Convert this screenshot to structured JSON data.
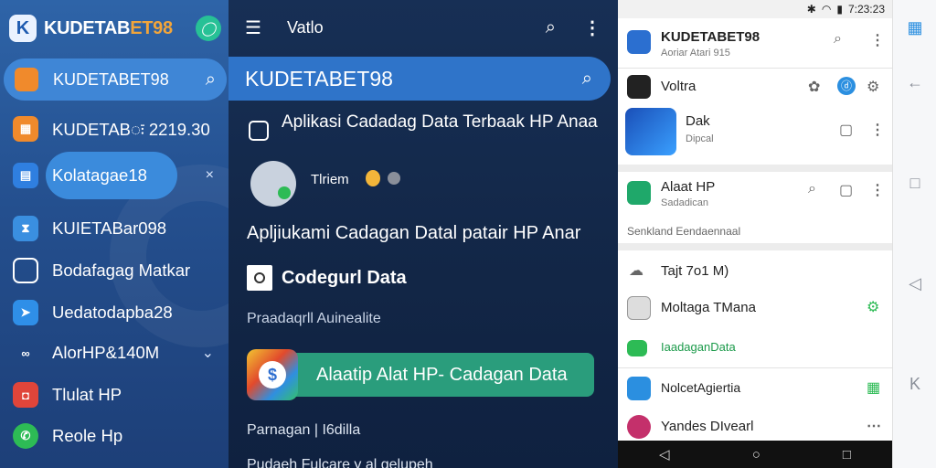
{
  "sidebar": {
    "title_main": "KUDETAB",
    "title_accent": "ET98",
    "search_label": "KUDETABET98",
    "items": [
      {
        "label": "KUDETABः 2219.30",
        "trail": ""
      },
      {
        "label": "Kolatagae18",
        "trail": "×"
      },
      {
        "label": "KUIETABar098",
        "trail": ""
      },
      {
        "label": "Bodafagag Matkar",
        "trail": ""
      },
      {
        "label": "Uedatodapba28",
        "trail": ""
      },
      {
        "label": "AlorHP&140M",
        "trail": "⌄"
      },
      {
        "label": "Tlulat HP",
        "trail": ""
      },
      {
        "label": "Reole Hp",
        "trail": ""
      }
    ]
  },
  "main": {
    "top_title": "Vatlo",
    "bar_title": "KUDETABET98",
    "card_title": "Aplikasi Cadadag Data Terbaak HP Anaa",
    "row_label": "Tlriem",
    "line1": "Apljiukami Cadagan Datal patair HP Anar",
    "section_title": "Codegurl Data",
    "section_sub": "Praadaqrll Auinealite",
    "cta_label": "Alaatip Alat HP- Cadagan Data",
    "footer": "Parnagan | I6dilla",
    "footer2": "Pudaeh Fulcare y al gelupeh"
  },
  "phone": {
    "status_time": "7:23:23",
    "header_title": "KUDETABET98",
    "header_sub": "Aoriar Atari 915",
    "row_volta": "Voltra",
    "row_dak_title": "Dak",
    "row_dak_sub": "Dipcal",
    "row_alat_title": "Alaat HP",
    "row_alat_sub": "Sadadican",
    "section_label": "Senkland Eendaennaal",
    "list": [
      "Tajt 7o1 M)",
      "Moltaga TMana",
      "IaadaganData",
      "NolcetAgiertia",
      "Yandes DIvearl"
    ]
  },
  "colors": {
    "accent_orange": "#f2a53a",
    "accent_green": "#2a9d7c",
    "brand_blue": "#2f74c9"
  }
}
